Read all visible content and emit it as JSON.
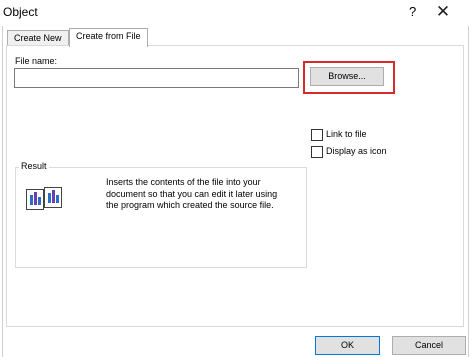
{
  "window": {
    "title": "Object",
    "help_label": "?",
    "close_label": "✕"
  },
  "tabs": [
    {
      "label": "Create New",
      "active": false
    },
    {
      "label": "Create from File",
      "active": true
    }
  ],
  "file": {
    "label": "File name:",
    "value": "",
    "browse_label": "Browse..."
  },
  "options": {
    "link_to_file": {
      "label": "Link to file",
      "checked": false
    },
    "display_as_icon": {
      "label": "Display as icon",
      "checked": false
    }
  },
  "result": {
    "label": "Result",
    "text": "Inserts the contents of the file into your document so that you can edit it later using the program which created the source file."
  },
  "buttons": {
    "ok": "OK",
    "cancel": "Cancel"
  },
  "colors": {
    "highlight": "#d72a2a",
    "accent": "#0078d7"
  }
}
